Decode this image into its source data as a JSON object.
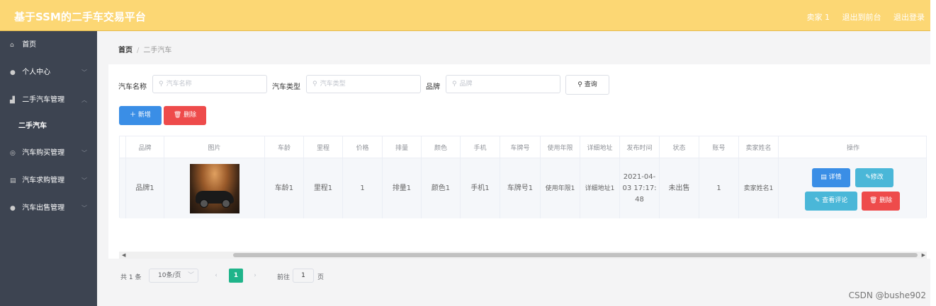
{
  "header": {
    "title": "基于SSM的二手车交易平台",
    "user": "卖家 1",
    "back_to_front": "退出到前台",
    "logout": "退出登录"
  },
  "sidebar": {
    "items": [
      {
        "label": "首页",
        "icon": "home-icon"
      },
      {
        "label": "个人中心",
        "icon": "user-icon"
      },
      {
        "label": "二手汽车管理",
        "icon": "car-icon"
      },
      {
        "label": "二手汽车",
        "sub": true
      },
      {
        "label": "汽车购买管理",
        "icon": "compass-icon"
      },
      {
        "label": "汽车求购管理",
        "icon": "doc-icon"
      },
      {
        "label": "汽车出售管理",
        "icon": "user-icon"
      }
    ]
  },
  "breadcrumb": {
    "home": "首页",
    "current": "二手汽车"
  },
  "search": {
    "name_label": "汽车名称",
    "name_placeholder": "汽车名称",
    "type_label": "汽车类型",
    "type_placeholder": "汽车类型",
    "brand_label": "品牌",
    "brand_placeholder": "品牌",
    "query_label": "查询"
  },
  "actions": {
    "add_label": "新增",
    "delete_label": "删除"
  },
  "table": {
    "headers": [
      "品牌",
      "图片",
      "车龄",
      "里程",
      "价格",
      "排量",
      "颜色",
      "手机",
      "车牌号",
      "使用年限",
      "详细地址",
      "发布时间",
      "状态",
      "账号",
      "卖家姓名",
      "操作"
    ],
    "rows": [
      {
        "brand": "品牌1",
        "age": "车龄1",
        "mileage": "里程1",
        "price": "1",
        "displacement": "排量1",
        "color": "颜色1",
        "phone": "手机1",
        "plate": "车牌号1",
        "years": "使用年限1",
        "address": "详细地址1",
        "publish_time": "2021-04-03 17:17:48",
        "status": "未出售",
        "account": "1",
        "seller": "卖家姓名1"
      }
    ],
    "op_detail": "详情",
    "op_edit": "修改",
    "op_comments": "查看评论",
    "op_delete": "删除"
  },
  "pagination": {
    "total": "共 1 条",
    "page_size": "10条/页",
    "current_page": "1",
    "goto_label": "前往",
    "goto_value": "1",
    "goto_unit": "页"
  },
  "watermark": "CSDN @bushe902",
  "colors": {
    "header": "#fcd774",
    "sidebar": "#3d4451",
    "primary": "#3a8ee6",
    "danger": "#ee4b4b",
    "info": "#4ab7d8",
    "page_active": "#1fb48a"
  }
}
